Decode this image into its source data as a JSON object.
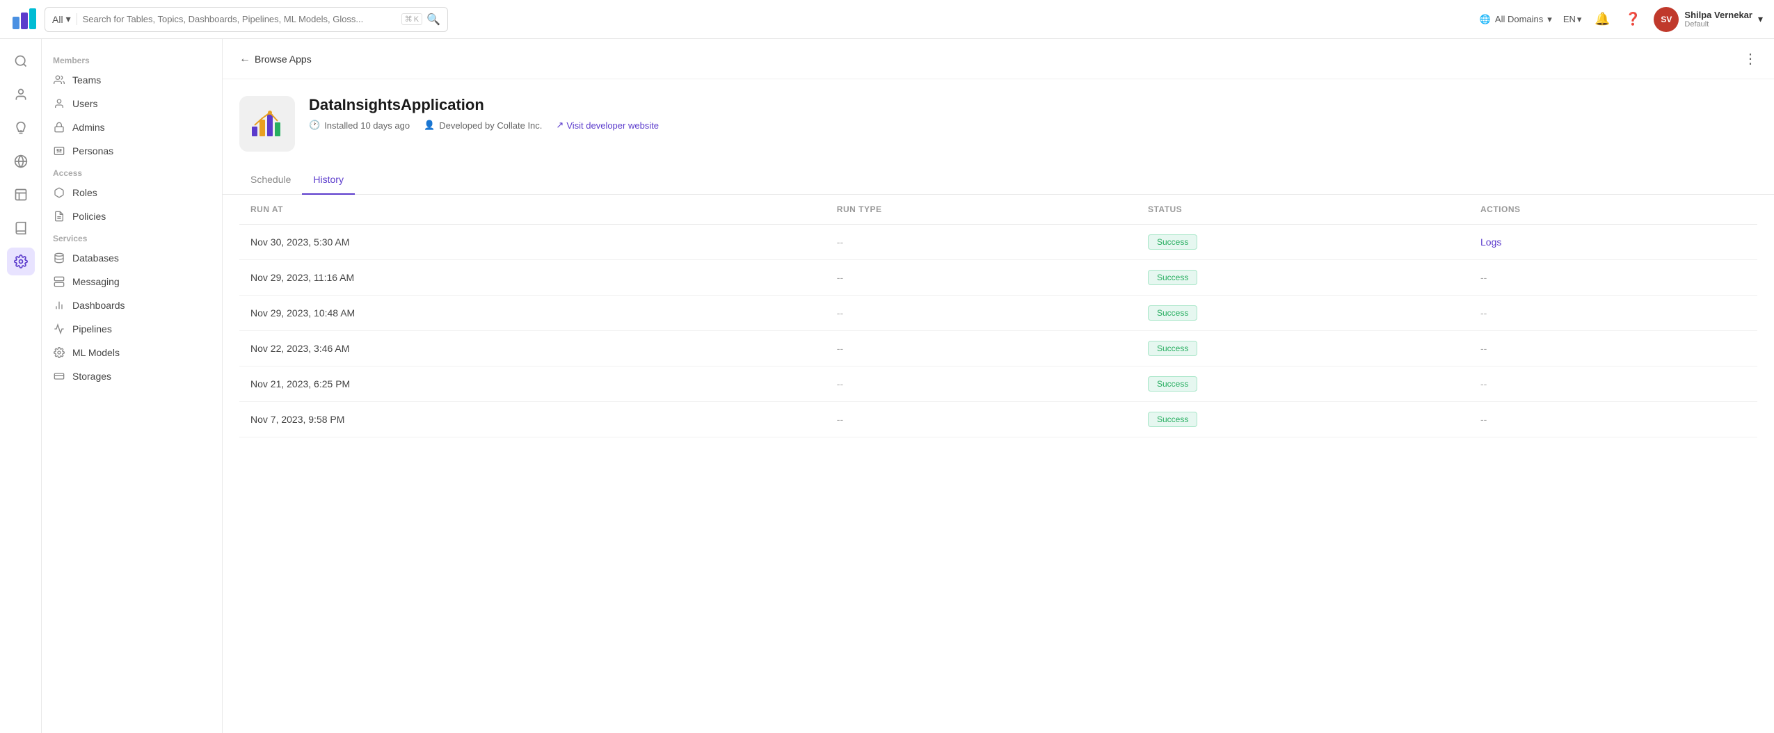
{
  "topNav": {
    "searchType": "All",
    "searchPlaceholder": "Search for Tables, Topics, Dashboards, Pipelines, ML Models, Gloss...",
    "shortcutKey": "⌘",
    "shortcutLetter": "K",
    "domain": "All Domains",
    "language": "EN",
    "user": {
      "name": "Shilpa Vernekar",
      "role": "Default",
      "initials": "SV"
    }
  },
  "sidebarIcons": [
    {
      "name": "explore-icon",
      "symbol": "🔍",
      "active": false
    },
    {
      "name": "governance-icon",
      "symbol": "👤",
      "active": false
    },
    {
      "name": "insights-icon",
      "symbol": "💡",
      "active": false
    },
    {
      "name": "domains-icon",
      "symbol": "🌐",
      "active": false
    },
    {
      "name": "data-quality-icon",
      "symbol": "🏛",
      "active": false
    },
    {
      "name": "observability-icon",
      "symbol": "📖",
      "active": false
    },
    {
      "name": "settings-icon",
      "symbol": "⚙",
      "active": true
    }
  ],
  "leftNav": {
    "sections": [
      {
        "label": "Members",
        "items": [
          {
            "name": "teams",
            "label": "Teams",
            "icon": "👥"
          },
          {
            "name": "users",
            "label": "Users",
            "icon": "👤"
          },
          {
            "name": "admins",
            "label": "Admins",
            "icon": "🛡"
          },
          {
            "name": "personas",
            "label": "Personas",
            "icon": "🪪"
          }
        ]
      },
      {
        "label": "Access",
        "items": [
          {
            "name": "roles",
            "label": "Roles",
            "icon": "🔑"
          },
          {
            "name": "policies",
            "label": "Policies",
            "icon": "📋"
          }
        ]
      },
      {
        "label": "Services",
        "items": [
          {
            "name": "databases",
            "label": "Databases",
            "icon": "🗄"
          },
          {
            "name": "messaging",
            "label": "Messaging",
            "icon": "📊"
          },
          {
            "name": "dashboards",
            "label": "Dashboards",
            "icon": "📉"
          },
          {
            "name": "pipelines",
            "label": "Pipelines",
            "icon": "🔧"
          },
          {
            "name": "ml-models",
            "label": "ML Models",
            "icon": "⚙"
          },
          {
            "name": "storages",
            "label": "Storages",
            "icon": "🗃"
          }
        ]
      }
    ]
  },
  "page": {
    "backLabel": "Browse Apps",
    "appName": "DataInsightsApplication",
    "installedText": "Installed 10 days ago",
    "developerText": "Developed by Collate Inc.",
    "visitLinkText": "Visit developer website",
    "tabs": [
      {
        "id": "schedule",
        "label": "Schedule",
        "active": false
      },
      {
        "id": "history",
        "label": "History",
        "active": true
      }
    ],
    "table": {
      "columns": [
        "RUN AT",
        "RUN TYPE",
        "STATUS",
        "ACTIONS"
      ],
      "rows": [
        {
          "runAt": "Nov 30, 2023, 5:30 AM",
          "runType": "--",
          "status": "Success",
          "action": "Logs",
          "actionType": "link"
        },
        {
          "runAt": "Nov 29, 2023, 11:16 AM",
          "runType": "--",
          "status": "Success",
          "action": "--",
          "actionType": "text"
        },
        {
          "runAt": "Nov 29, 2023, 10:48 AM",
          "runType": "--",
          "status": "Success",
          "action": "--",
          "actionType": "text"
        },
        {
          "runAt": "Nov 22, 2023, 3:46 AM",
          "runType": "--",
          "status": "Success",
          "action": "--",
          "actionType": "text"
        },
        {
          "runAt": "Nov 21, 2023, 6:25 PM",
          "runType": "--",
          "status": "Success",
          "action": "--",
          "actionType": "text"
        },
        {
          "runAt": "Nov 7, 2023, 9:58 PM",
          "runType": "--",
          "status": "Success",
          "action": "--",
          "actionType": "text"
        }
      ]
    }
  }
}
